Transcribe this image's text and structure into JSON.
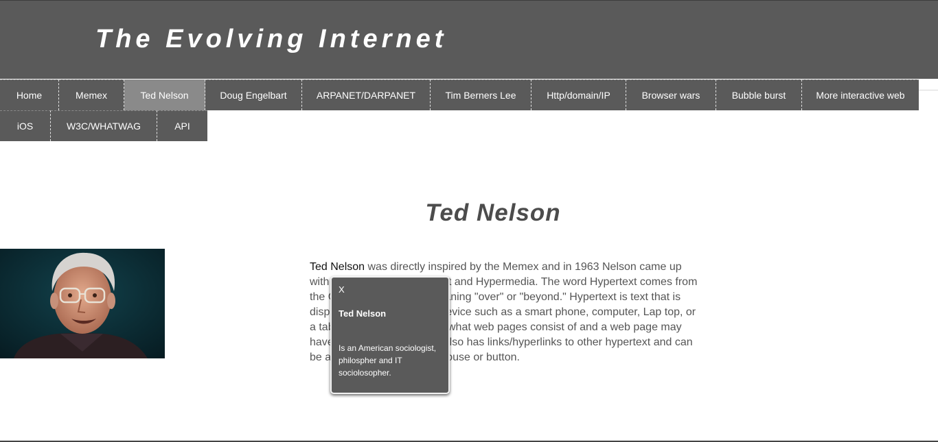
{
  "header": {
    "title": "The Evolving Internet"
  },
  "nav": {
    "row1": [
      {
        "label": "Home"
      },
      {
        "label": "Memex"
      },
      {
        "label": "Ted Nelson",
        "active": true
      },
      {
        "label": "Doug Engelbart"
      },
      {
        "label": "ARPANET/DARPANET"
      },
      {
        "label": "Tim Berners Lee"
      },
      {
        "label": "Http/domain/IP"
      },
      {
        "label": "Browser wars"
      },
      {
        "label": "Bubble burst"
      },
      {
        "label": "More interactive web"
      }
    ],
    "row2": [
      {
        "label": "iOS"
      },
      {
        "label": "W3C/WHATWAG"
      },
      {
        "label": "API"
      }
    ]
  },
  "main": {
    "heading": "Ted Nelson",
    "link_term": "Ted Nelson",
    "paragraph_rest": " was directly inspired by the Memex and in 1963 Nelson came up with the concept of Hypertext and Hypermedia. The word Hypertext comes from the Greek prefix \"hyper\" meaning \"over\" or \"beyond.\" Hypertext is text that is displayed on an electronic device such as a smart phone, computer, Lap top, or a tablet device. Hypertext is what web pages consist of and a web page may have tables, images, etc. It also has links/hyperlinks to other hypertext and can be accessed by clicking a mouse or button.",
    "portrait_alt": "Ted Nelson"
  },
  "tooltip": {
    "close_label": "X",
    "title": "Ted Nelson",
    "body": "Is an American sociologist, philospher and IT sociolosopher."
  },
  "colors": {
    "header_bg": "#5a5a5a",
    "nav_active": "#8a8a8a",
    "heading_text": "#4c4c4c"
  }
}
